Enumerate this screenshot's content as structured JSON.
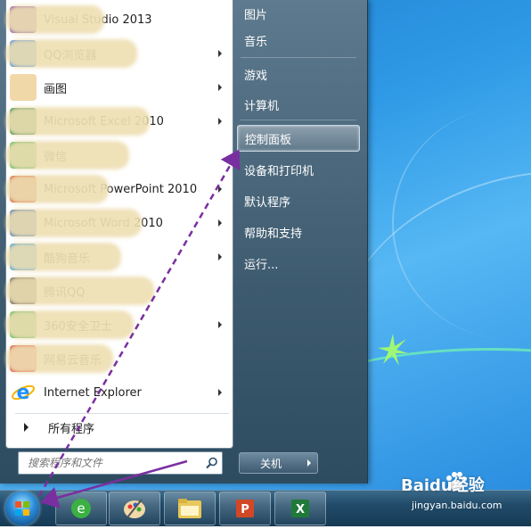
{
  "programs": [
    {
      "label": "Visual Studio 2013",
      "icon": "vs-icon",
      "has_arrow": false
    },
    {
      "label": "QQ浏览器",
      "icon": "qqbrowser-icon",
      "has_arrow": true
    },
    {
      "label": "画图",
      "icon": "paint-icon",
      "has_arrow": true
    },
    {
      "label": "Microsoft Excel 2010",
      "icon": "excel-icon",
      "has_arrow": true
    },
    {
      "label": "微信",
      "icon": "wechat-icon",
      "has_arrow": false
    },
    {
      "label": "Microsoft PowerPoint 2010",
      "icon": "powerpoint-icon",
      "has_arrow": true
    },
    {
      "label": "Microsoft Word 2010",
      "icon": "word-icon",
      "has_arrow": true
    },
    {
      "label": "酷狗音乐",
      "icon": "kugou-icon",
      "has_arrow": true
    },
    {
      "label": "腾讯QQ",
      "icon": "qq-icon",
      "has_arrow": false
    },
    {
      "label": "360安全卫士",
      "icon": "360-icon",
      "has_arrow": true
    },
    {
      "label": "网易云音乐",
      "icon": "music-icon",
      "has_arrow": false
    },
    {
      "label": "Internet Explorer",
      "icon": "ie-icon",
      "has_arrow": true
    }
  ],
  "all_programs": "所有程序",
  "search_placeholder": "搜索程序和文件",
  "right_items": [
    "图片",
    "音乐",
    "游戏",
    "计算机",
    "控制面板",
    "设备和打印机",
    "默认程序",
    "帮助和支持",
    "运行..."
  ],
  "highlighted_right_item": "控制面板",
  "shutdown_label": "关机",
  "watermark": {
    "brand": "Baidu经验",
    "url": "jingyan.baidu.com"
  },
  "colors": {
    "arrow": "#7a2fa0",
    "menu_bg": "#3d5a6e",
    "highlight": "#c8d8e4"
  }
}
